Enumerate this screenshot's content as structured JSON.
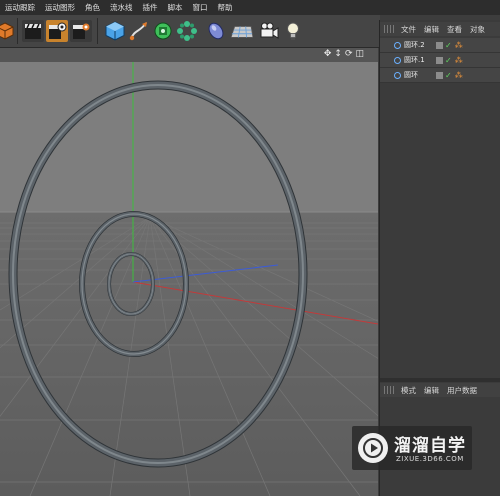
{
  "menubar": {
    "items": [
      "运动跟踪",
      "运动图形",
      "角色",
      "流水线",
      "插件",
      "脚本",
      "窗口",
      "帮助"
    ]
  },
  "toolbar": {
    "groups": [
      [
        "cube-icon",
        "clapper-icon",
        "clapper-gear-icon",
        "clapper-motion-icon"
      ],
      [
        "primitive-cube-icon",
        "spline-pen-icon",
        "nurbs-icon",
        "array-icon",
        "deformer-icon",
        "floor-icon",
        "camera-icon",
        "light-icon"
      ]
    ]
  },
  "viewport": {
    "nav_icons": [
      "move-icon",
      "zoom-icon",
      "rotate-icon",
      "maximize-icon"
    ],
    "scene": {
      "large_torus": "圆环.2",
      "medium_torus": "圆环.1",
      "small_torus": "圆环"
    }
  },
  "object_manager": {
    "tabs": [
      "文件",
      "编辑",
      "查看",
      "对象"
    ],
    "objects": [
      {
        "name": "圆环.2"
      },
      {
        "name": "圆环.1"
      },
      {
        "name": "圆环"
      }
    ]
  },
  "attribute_manager": {
    "tabs": [
      "模式",
      "编辑",
      "用户数据"
    ]
  },
  "watermark": {
    "title": "溜溜自学",
    "url": "ZIXUE.3D66.COM"
  },
  "colors": {
    "torus": "#5c6369",
    "viewport_bg": "#7c7c7c",
    "axis_x": "#c23a3a",
    "axis_y": "#3cbf3c",
    "axis_z": "#3c5cd6",
    "object_icon": "#6ab0ff",
    "tag": "#e8923b"
  }
}
